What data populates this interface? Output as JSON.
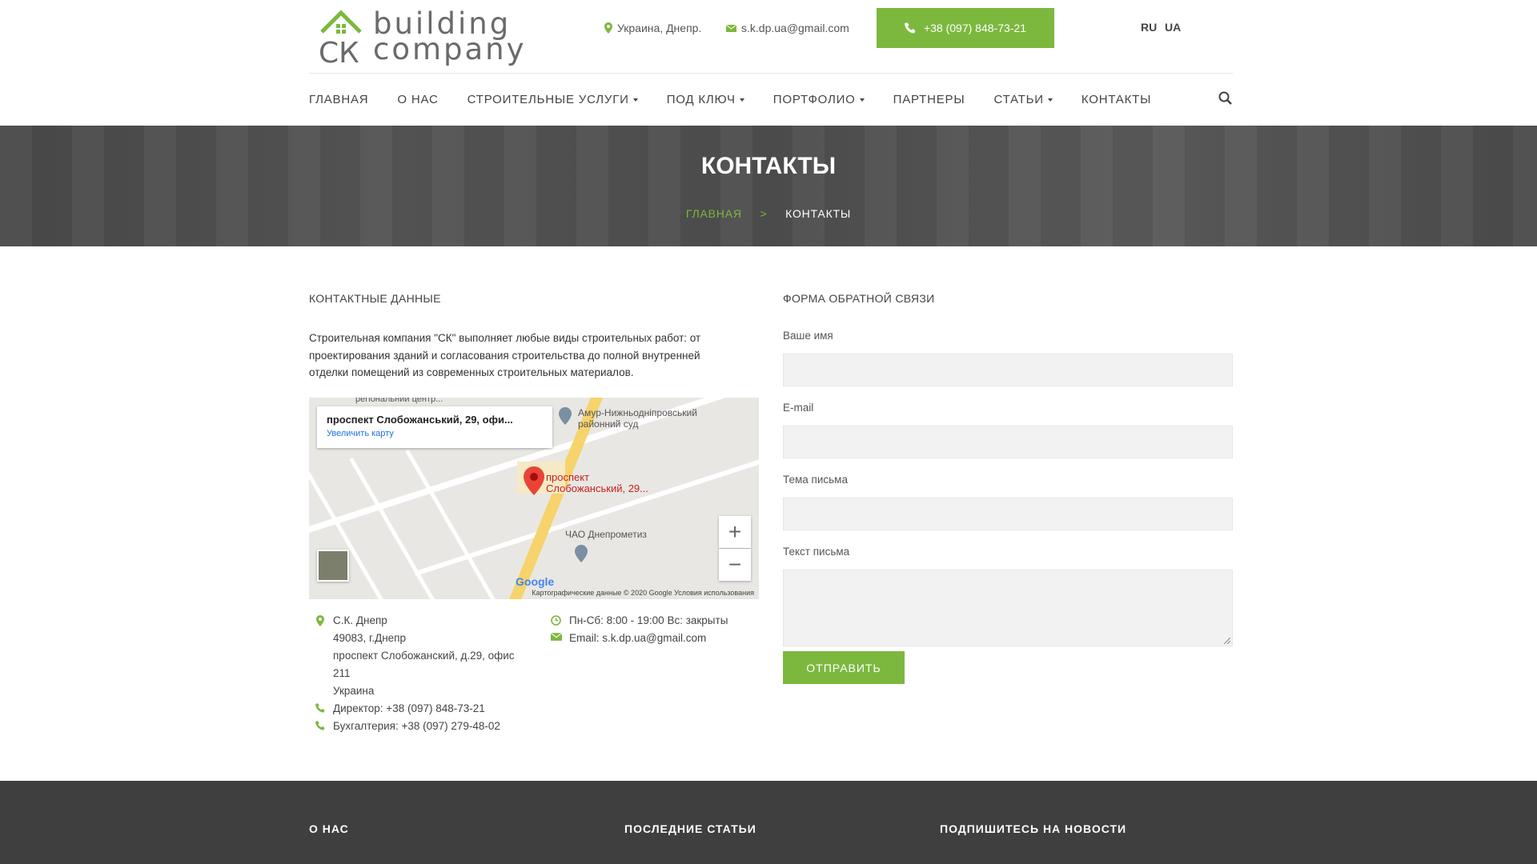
{
  "brand": {
    "logo_line1": "building",
    "logo_line2": "company",
    "logo_mark": "СК"
  },
  "header": {
    "location": "Украина, Днепр.",
    "email": "s.k.dp.ua@gmail.com",
    "phone": "+38 (097) 848-73-21",
    "langs": [
      "RU",
      "UA"
    ]
  },
  "nav": {
    "items": [
      {
        "label": "ГЛАВНАЯ",
        "dropdown": false
      },
      {
        "label": "О НАС",
        "dropdown": false
      },
      {
        "label": "СТРОИТЕЛЬНЫЕ УСЛУГИ",
        "dropdown": true
      },
      {
        "label": "ПОД КЛЮЧ",
        "dropdown": true
      },
      {
        "label": "ПОРТФОЛИО",
        "dropdown": true
      },
      {
        "label": "ПАРТНЕРЫ",
        "dropdown": false
      },
      {
        "label": "СТАТЬИ",
        "dropdown": true
      },
      {
        "label": "КОНТАКТЫ",
        "dropdown": false
      }
    ]
  },
  "hero": {
    "title": "КОНТАКТЫ",
    "breadcrumb_home": "ГЛАВНАЯ",
    "breadcrumb_sep": ">",
    "breadcrumb_current": "КОНТАКТЫ"
  },
  "contacts": {
    "heading": "КОНТАКТНЫЕ ДАННЫЕ",
    "intro": "Строительная компания \"СК\" выполняет любые виды строительных работ: от проектирования зданий и согласования строительства до полной внутренней отделки помещений из современных строительных материалов.",
    "address_lines": [
      "С.К. Днепр",
      "49083, г.Днепр",
      "проспект Слобожанский, д.29, офис 211",
      "Украина"
    ],
    "director": "Директор: +38 (097) 848-73-21",
    "accounting": "Бухгалтерия: +38 (097) 279-48-02",
    "hours": "Пн-Сб: 8:00 - 19:00 Вс: закрыты",
    "email": "Email: s.k.dp.ua@gmail.com"
  },
  "map": {
    "card_title": "проспект Слобожанський, 29, офи...",
    "card_link": "Увеличить карту",
    "marker_label_1": "проспект",
    "marker_label_2": "Слобожанський, 29...",
    "poi_1_line1": "Амур-Нижньодніпровський",
    "poi_1_line2": "районний суд",
    "poi_2": "ЧАО Днепрометиз",
    "top_label": "регіональний центр...",
    "zoom_in": "+",
    "zoom_out": "−",
    "google": "Google",
    "footer_text": "Картографические данные © 2020 Google    Условия использования"
  },
  "form": {
    "heading": "ФОРМА ОБРАТНОЙ СВЯЗИ",
    "name_label": "Ваше имя",
    "email_label": "E-mail",
    "subject_label": "Тема письма",
    "message_label": "Текст письма",
    "submit_label": "ОТПРАВИТЬ"
  },
  "footer": {
    "col1": "О НАС",
    "col2": "ПОСЛЕДНИЕ СТАТЬИ",
    "col3": "ПОДПИШИТЕСЬ НА НОВОСТИ"
  },
  "colors": {
    "accent": "#7cb83e",
    "dark": "#3f3f3f",
    "hero": "#505050"
  }
}
